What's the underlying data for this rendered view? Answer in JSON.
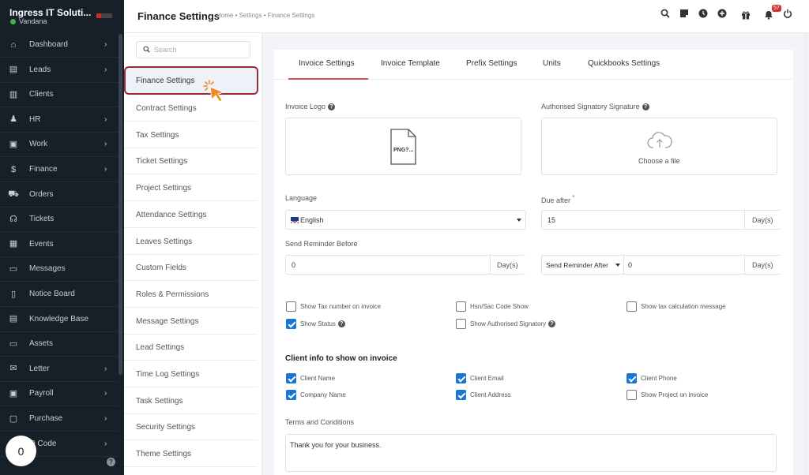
{
  "sidebar": {
    "company": "Ingress IT Soluti...",
    "user": "Vandana",
    "items": [
      {
        "label": "Dashboard",
        "icon": "home-icon",
        "chevron": true
      },
      {
        "label": "Leads",
        "icon": "id-card-icon",
        "chevron": true
      },
      {
        "label": "Clients",
        "icon": "bar-chart-icon",
        "chevron": false
      },
      {
        "label": "HR",
        "icon": "users-icon",
        "chevron": true
      },
      {
        "label": "Work",
        "icon": "briefcase-icon",
        "chevron": true
      },
      {
        "label": "Finance",
        "icon": "dollar-icon",
        "chevron": true
      },
      {
        "label": "Orders",
        "icon": "cart-icon",
        "chevron": false
      },
      {
        "label": "Tickets",
        "icon": "headset-icon",
        "chevron": false
      },
      {
        "label": "Events",
        "icon": "calendar-icon",
        "chevron": false
      },
      {
        "label": "Messages",
        "icon": "chat-icon",
        "chevron": false
      },
      {
        "label": "Notice Board",
        "icon": "clipboard-icon",
        "chevron": false
      },
      {
        "label": "Knowledge Base",
        "icon": "book-icon",
        "chevron": false
      },
      {
        "label": "Assets",
        "icon": "monitor-icon",
        "chevron": false
      },
      {
        "label": "Letter",
        "icon": "envelope-icon",
        "chevron": true
      },
      {
        "label": "Payroll",
        "icon": "wallet-icon",
        "chevron": true
      },
      {
        "label": "Purchase",
        "icon": "bag-icon",
        "chevron": true
      },
      {
        "label": "Q Code",
        "icon": "qr-icon",
        "chevron": true
      }
    ],
    "bottom_count": "0"
  },
  "header": {
    "title": "Finance Settings",
    "breadcrumb": "Home • Settings • Finance Settings",
    "notification_count": "57"
  },
  "settings_menu": {
    "search_placeholder": "Search",
    "active": "Finance Settings",
    "items": [
      "Contract Settings",
      "Tax Settings",
      "Ticket Settings",
      "Project Settings",
      "Attendance Settings",
      "Leaves Settings",
      "Custom Fields",
      "Roles & Permissions",
      "Message Settings",
      "Lead Settings",
      "Time Log Settings",
      "Task Settings",
      "Security Settings",
      "Theme Settings"
    ]
  },
  "tabs": [
    "Invoice Settings",
    "Invoice Template",
    "Prefix Settings",
    "Units",
    "Quickbooks Settings"
  ],
  "form": {
    "invoice_logo_label": "Invoice Logo",
    "logo_placeholder": "PNG?...",
    "signature_label": "Authorised Signatory Signature",
    "choose_file": "Choose a file",
    "language_label": "Language",
    "language_value": "English",
    "due_after_label": "Due after",
    "due_after_value": "15",
    "days_addon": "Day(s)",
    "send_reminder_before_label": "Send Reminder Before",
    "send_reminder_before_value": "0",
    "send_reminder_after_select": "Send Reminder After",
    "send_reminder_after_value": "0"
  },
  "checkboxes_top": [
    {
      "label": "Show Tax number on invoice",
      "checked": false
    },
    {
      "label": "Hsn/Sac Code Show",
      "checked": false
    },
    {
      "label": "Show tax calculation message",
      "checked": false
    },
    {
      "label": "Show Status",
      "checked": true
    },
    {
      "label": "Show Authorised Signatory",
      "checked": false
    }
  ],
  "client_info_title": "Client info to show on invoice",
  "checkboxes_client": [
    {
      "label": "Client Name",
      "checked": true
    },
    {
      "label": "Client Email",
      "checked": true
    },
    {
      "label": "Client Phone",
      "checked": true
    },
    {
      "label": "Company Name",
      "checked": true
    },
    {
      "label": "Client Address",
      "checked": true
    },
    {
      "label": "Show Project on invoice",
      "checked": false
    }
  ],
  "terms_label": "Terms and Conditions",
  "terms_value": "Thank you for your business.",
  "colors": {
    "sidebar_bg": "#171f29",
    "accent_red": "#d9534f",
    "checkbox_blue": "#1976d2",
    "highlight_border": "#9c2b3a"
  }
}
